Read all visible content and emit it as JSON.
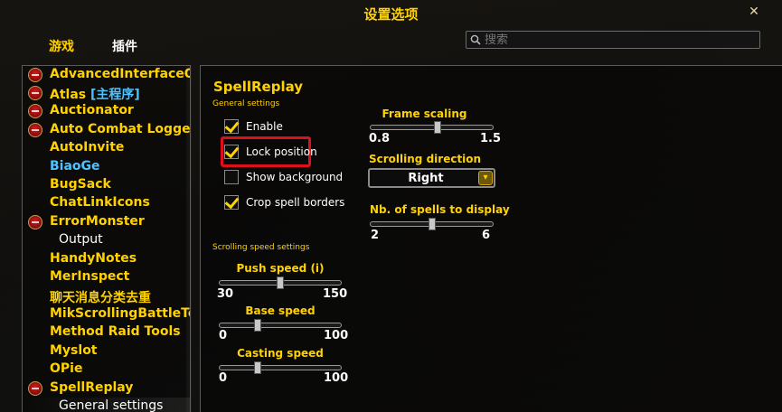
{
  "window": {
    "title": "设置选项",
    "close_label": "✕"
  },
  "tabs": [
    {
      "label": "游戏",
      "active": true
    },
    {
      "label": "插件",
      "active": false
    }
  ],
  "search": {
    "placeholder": "搜索",
    "value": ""
  },
  "addon_list": [
    {
      "label": "AdvancedInterfaceOp...",
      "toggle": true,
      "style": "normal"
    },
    {
      "label": "Atlas ",
      "tag": "[主程序]",
      "toggle": true,
      "style": "normal"
    },
    {
      "label": "Auctionator",
      "toggle": true,
      "style": "normal"
    },
    {
      "label": "Auto Combat Logger",
      "toggle": true,
      "style": "normal"
    },
    {
      "label": "AutoInvite",
      "toggle": false,
      "style": "normal"
    },
    {
      "label": "BiaoGe",
      "toggle": false,
      "style": "blue"
    },
    {
      "label": "BugSack",
      "toggle": false,
      "style": "normal"
    },
    {
      "label": "ChatLinkIcons",
      "toggle": false,
      "style": "normal"
    },
    {
      "label": "ErrorMonster",
      "toggle": true,
      "style": "normal"
    },
    {
      "label": "Output",
      "toggle": false,
      "style": "sub"
    },
    {
      "label": "HandyNotes",
      "toggle": false,
      "style": "normal"
    },
    {
      "label": "MerInspect",
      "toggle": false,
      "style": "normal"
    },
    {
      "label": "聊天消息分类去重",
      "toggle": false,
      "style": "normal"
    },
    {
      "label": "MikScrollingBattleText",
      "toggle": false,
      "style": "normal"
    },
    {
      "label": "Method Raid Tools",
      "toggle": false,
      "style": "normal"
    },
    {
      "label": "Myslot",
      "toggle": false,
      "style": "normal"
    },
    {
      "label": "OPie",
      "toggle": false,
      "style": "normal"
    },
    {
      "label": "SpellReplay",
      "toggle": true,
      "style": "normal"
    },
    {
      "label": "General settings",
      "toggle": false,
      "style": "sub",
      "selected": true
    }
  ],
  "panel": {
    "title": "SpellReplay",
    "general_section": "General settings",
    "checkboxes": [
      {
        "label": "Enable",
        "checked": true
      },
      {
        "label": "Lock position",
        "checked": true,
        "highlighted": true
      },
      {
        "label": "Show background",
        "checked": false
      },
      {
        "label": "Crop spell borders",
        "checked": true
      }
    ],
    "speed_section": "Scrolling speed settings",
    "speed_sliders": [
      {
        "label": "Push speed (i)",
        "min": "30",
        "max": "150",
        "fraction": 0.5
      },
      {
        "label": "Base speed",
        "min": "0",
        "max": "100",
        "fraction": 0.3
      },
      {
        "label": "Casting speed",
        "min": "0",
        "max": "100",
        "fraction": 0.3
      }
    ],
    "frame_scaling": {
      "label": "Frame scaling",
      "min": "0.8",
      "max": "1.5",
      "fraction": 0.55
    },
    "scroll_direction": {
      "label": "Scrolling direction",
      "value": "Right"
    },
    "nb_spells": {
      "label": "Nb. of spells to display",
      "min": "2",
      "max": "6",
      "fraction": 0.5
    }
  },
  "colors": {
    "accent": "#ffd200",
    "link": "#4fc3ff",
    "highlight": "#e0101a"
  }
}
